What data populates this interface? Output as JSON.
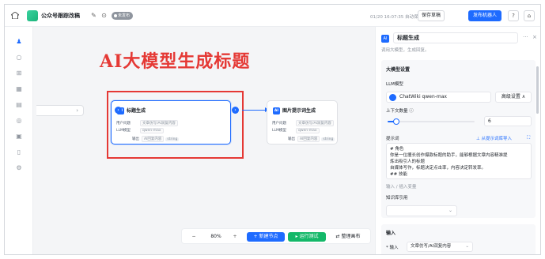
{
  "topbar": {
    "title": "公众号跟踪改稿",
    "edit_icon": "pencil-icon",
    "history_icon": "clock-icon",
    "badge": "未发布",
    "status": "01/20 16:07:35 自动保存草稿",
    "save_label": "保存草稿",
    "publish_label": "发布机器人",
    "help_icon": "help-icon",
    "lock_icon": "lock-icon"
  },
  "canvas": {
    "heading": "AI大模型生成标题",
    "zoom": "80%",
    "add_node": "新建节点",
    "run_test": "运行测试",
    "arrange": "整理画布"
  },
  "node1": {
    "title": "标题生成",
    "row1_label": "用户问题",
    "row1_value": "文章仿写/AI润复内容",
    "row2_label": "LLM模型",
    "row2_value": "qwen-max",
    "row3_label": "输出",
    "row3_value": "AI回复内容",
    "row3_tag": "string"
  },
  "node2": {
    "title": "图片提示词生成",
    "row1_label": "用户问题",
    "row1_value": "文章仿写/AI润复内容",
    "row2_label": "LLM模型",
    "row2_value": "qwen-max",
    "row3_label": "输出",
    "row3_value": "AI回复内容",
    "row3_tag": "string"
  },
  "panel": {
    "title": "标题生成",
    "description": "调用大模型，生成回复。",
    "section_title": "大模型设置",
    "llm_label": "LLM模型",
    "model": "ChatWiki qwen-max",
    "advanced": "高级设置",
    "context_label": "上下文数量",
    "context_value": "6",
    "context_level": 0.1,
    "prompt_label": "提示词",
    "prompt_link": "从提示词库导入",
    "prompt_lines": [
      "# 角色",
      "你是一位擅长创作爆款标题的助手，能够根据文章内容精准提",
      "炼出吸引人的标题",
      "自媒体写作，标题决定点击率，内容决定转发率。",
      "## 技能"
    ],
    "prompt_placeholder": "输入 / 插入变量",
    "kb_label": "知识库引用",
    "input_section": "输入",
    "input_label": "* 输入",
    "input_value": "文章仿写/AI润复内容"
  },
  "colors": {
    "accent": "#1e6bff",
    "run": "#14b869",
    "annotation": "#e53935"
  }
}
